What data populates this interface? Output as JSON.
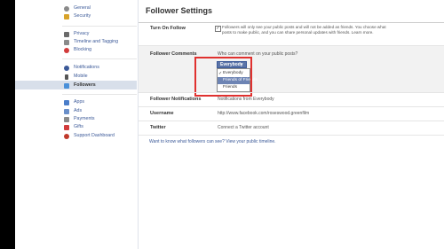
{
  "sidebar": {
    "groups": [
      [
        {
          "label": "General",
          "icon": "gear-icon",
          "color": "#8a8a8a"
        },
        {
          "label": "Security",
          "icon": "shield-icon",
          "color": "#d8a32a"
        }
      ],
      [
        {
          "label": "Privacy",
          "icon": "lock-icon",
          "color": "#6a6a6a"
        },
        {
          "label": "Timeline and Tagging",
          "icon": "timeline-icon",
          "color": "#8a8a8a"
        },
        {
          "label": "Blocking",
          "icon": "blocking-icon",
          "color": "#d23b3b"
        }
      ],
      [
        {
          "label": "Notifications",
          "icon": "globe-icon",
          "color": "#3b5998"
        },
        {
          "label": "Mobile",
          "icon": "mobile-icon",
          "color": "#555555"
        },
        {
          "label": "Followers",
          "icon": "followers-icon",
          "color": "#4a90d9"
        }
      ],
      [
        {
          "label": "Apps",
          "icon": "apps-icon",
          "color": "#4a7dc9"
        },
        {
          "label": "Ads",
          "icon": "ads-icon",
          "color": "#6a8fc9"
        },
        {
          "label": "Payments",
          "icon": "payments-icon",
          "color": "#8a8a8a"
        },
        {
          "label": "Gifts",
          "icon": "gift-icon",
          "color": "#d23b3b"
        },
        {
          "label": "Support Dashboard",
          "icon": "support-icon",
          "color": "#c0392b"
        }
      ]
    ]
  },
  "page": {
    "title": "Follower Settings"
  },
  "rows": {
    "turn_on_follow": {
      "label": "Turn On Follow",
      "checkbox_mark": "✓",
      "description": "Followers will only see your public posts and will not be added as friends. You choose what posts to make public, and you can share personal updates with friends. Learn more."
    },
    "follower_comments": {
      "label": "Follower Comments",
      "question": "Who can comment on your public posts?",
      "dropdown_value": "Everybody",
      "dropdown_arrow": "▼",
      "menu_check": "✓",
      "options": [
        "Everybody",
        "Friends of Friends",
        "Friends"
      ]
    },
    "follower_notifications": {
      "label": "Follower Notifications",
      "value": "Notifications from Everybody"
    },
    "username": {
      "label": "Username",
      "value": "http://www.facebook.com/roseswood.greenfilm"
    },
    "twitter": {
      "label": "Twitter",
      "value": "Connect a Twitter account"
    }
  },
  "footer": {
    "note": "Want to know what followers can see? View your public timeline."
  },
  "colors": {
    "accent": "#3b5998",
    "highlight_box": "#e0312f",
    "active_nav": "#d8dfea"
  }
}
